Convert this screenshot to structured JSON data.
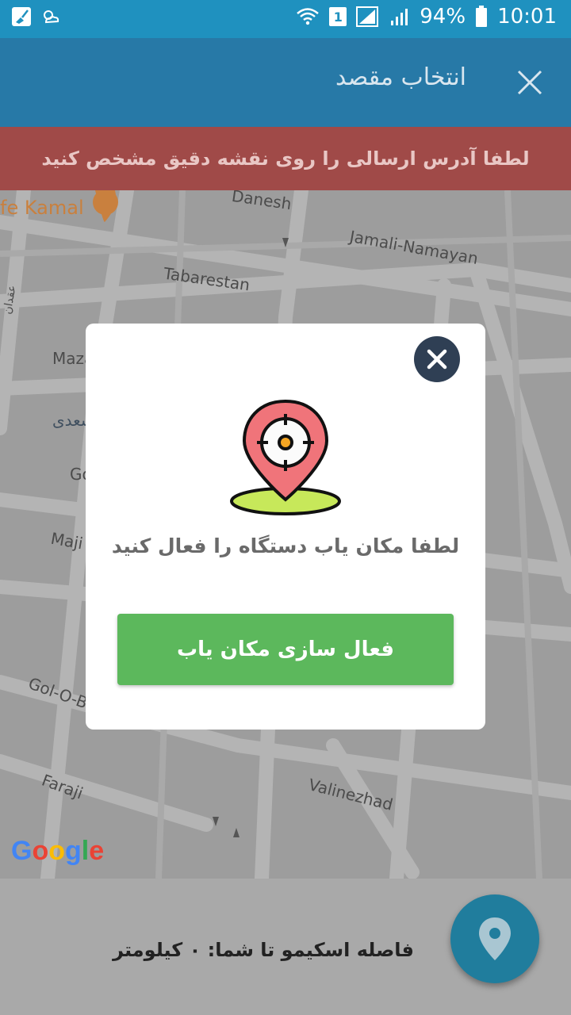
{
  "status_bar": {
    "battery": "94%",
    "time": "10:01",
    "sim": "1",
    "icons": [
      "broom-icon",
      "weather-icon",
      "wifi-icon",
      "sim-icon",
      "signal-icon",
      "battery-icon"
    ]
  },
  "app_bar": {
    "title": "انتخاب مقصد",
    "close_icon": "close-icon"
  },
  "alert": {
    "text": "لطفا آدرس ارسالی را روی نقشه دقیق مشخص کنید"
  },
  "map": {
    "labels": {
      "cafe": "fe Kamal",
      "danesh": "Danesh",
      "jamali": "Jamali-Namayan",
      "tabarestan": "Tabarestan",
      "maza": "Maza",
      "sadi": "سعدی",
      "go": "Go",
      "majid": "Maji",
      "golobo": "Gol-O-Bo",
      "faraji": "Faraji",
      "valinezhad": "Valinezhad",
      "side": "عقدان"
    },
    "attribution": "Google",
    "colors": {
      "background": "#9d9d9d",
      "road": "#b3b3b3"
    }
  },
  "modal": {
    "message": "لطفا مکان یاب دستگاه را فعال کنید",
    "button_label": "فعال سازی مکان یاب",
    "illustration_icon": "location-target-icon",
    "colors": {
      "button": "#5cb85c",
      "close_bg": "#2f3f54",
      "pin": "#f0747a",
      "base": "#c7e85a"
    }
  },
  "bottom_panel": {
    "distance_text": "فاصله اسکیمو تا شما: ۰ کیلومتر",
    "fab_icon": "location-pin-icon"
  }
}
